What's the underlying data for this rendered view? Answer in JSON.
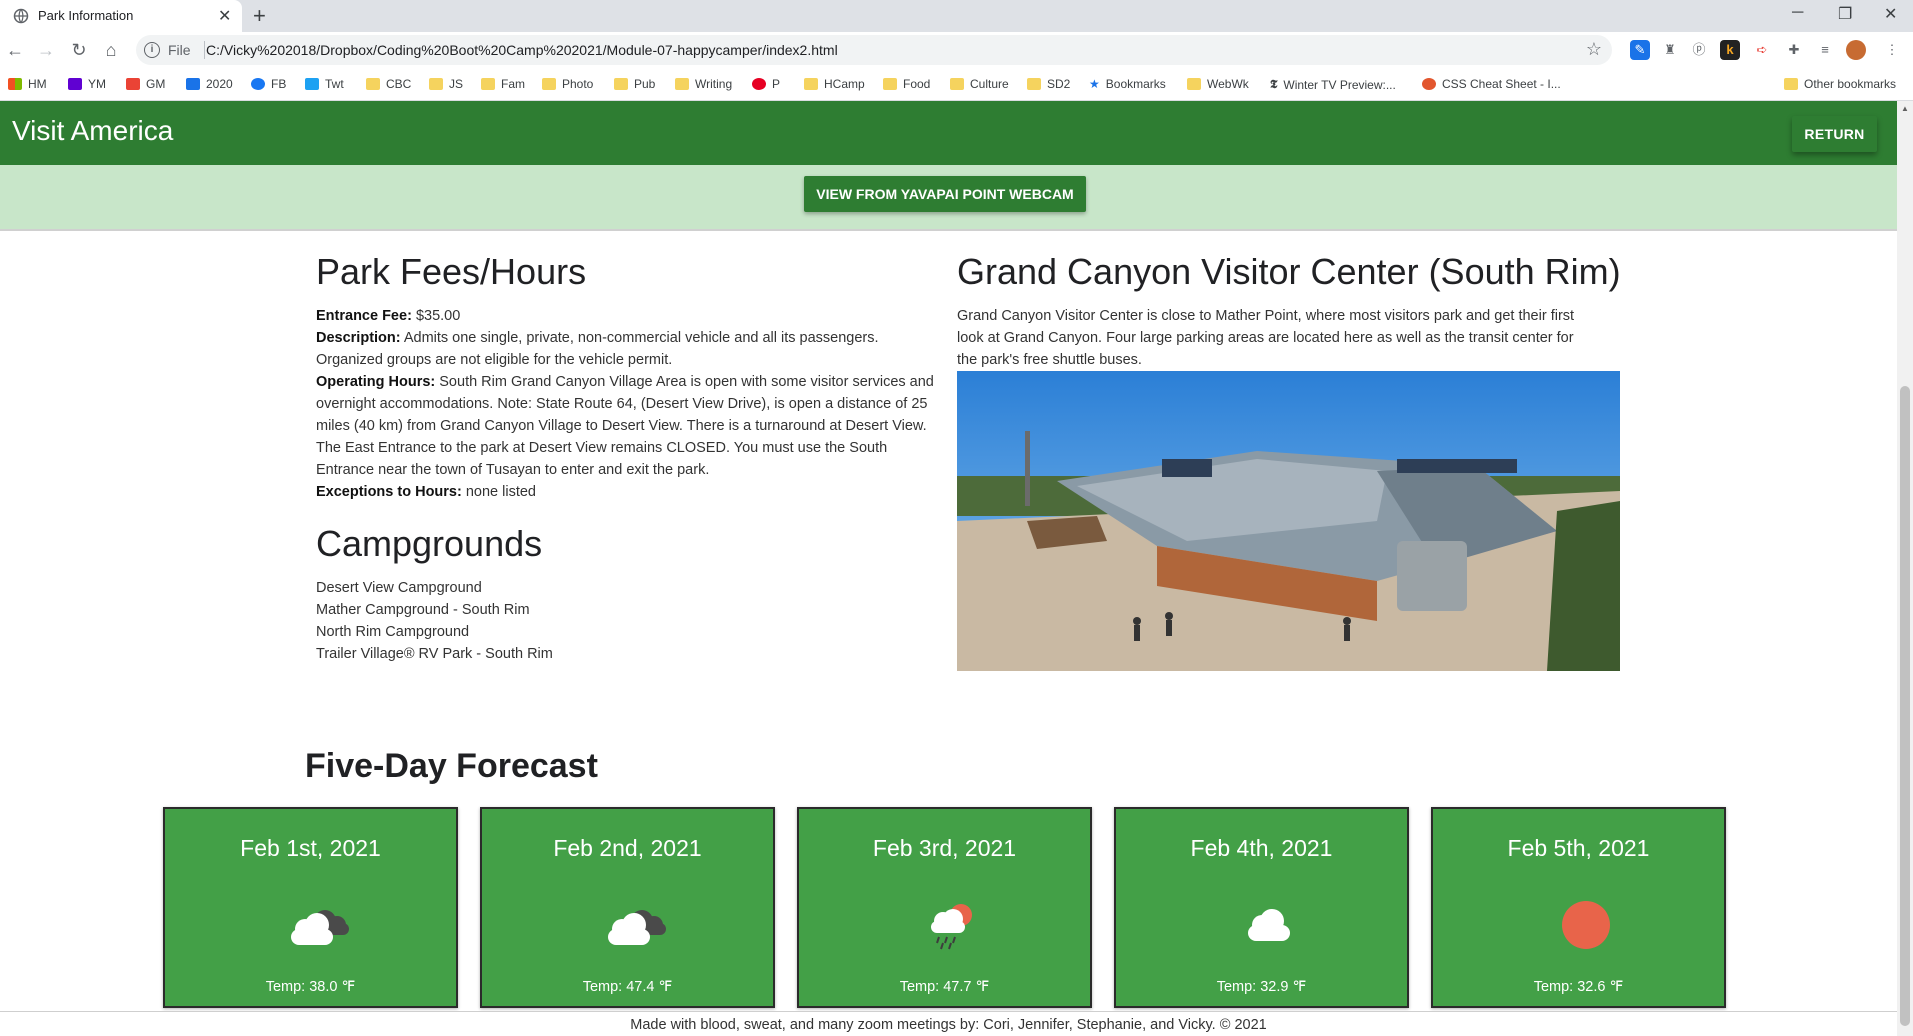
{
  "browser": {
    "tab_title": "Park Information",
    "url_scheme": "File",
    "url": "C:/Vicky%202018/Dropbox/Coding%20Boot%20Camp%202021/Module-07-happycamper/index2.html",
    "bookmarks": [
      "HM",
      "YM",
      "GM",
      "2020",
      "FB",
      "Twt",
      "CBC",
      "JS",
      "Fam",
      "Photo",
      "Pub",
      "Writing",
      "P",
      "HCamp",
      "Food",
      "Culture",
      "SD2",
      "Bookmarks",
      "WebWk",
      "Winter TV Preview:...",
      "CSS Cheat Sheet - I..."
    ],
    "other_bookmarks": "Other bookmarks"
  },
  "navbar": {
    "brand": "Visit America",
    "return_label": "RETURN"
  },
  "webcam": {
    "label": "VIEW FROM YAVAPAI POINT WEBCAM"
  },
  "fees": {
    "heading": "Park Fees/Hours",
    "entrance_label": "Entrance Fee:",
    "entrance_value": "$35.00",
    "description_label": "Description:",
    "description_value": "Admits one single, private, non-commercial vehicle and all its passengers. Organized groups are not eligible for the vehicle permit.",
    "hours_label": "Operating Hours:",
    "hours_value": "South Rim Grand Canyon Village Area is open with some visitor services and overnight accommodations. Note: State Route 64, (Desert View Drive), is open a distance of 25 miles (40 km) from Grand Canyon Village to Desert View. There is a turnaround at Desert View. The East Entrance to the park at Desert View remains CLOSED. You must use the South Entrance near the town of Tusayan to enter and exit the park.",
    "exceptions_label": "Exceptions to Hours:",
    "exceptions_value": "none listed"
  },
  "campgrounds": {
    "heading": "Campgrounds",
    "items": [
      "Desert View Campground",
      "Mather Campground - South Rim",
      "North Rim Campground",
      "Trailer Village® RV Park - South Rim"
    ]
  },
  "visitor_center": {
    "heading": "Grand Canyon Visitor Center (South Rim)",
    "description": "Grand Canyon Visitor Center is close to Mather Point, where most visitors park and get their first look at Grand Canyon. Four large parking areas are located here as well as the transit center for the park's free shuttle buses."
  },
  "forecast": {
    "heading": "Five-Day Forecast",
    "days": [
      {
        "date": "Feb 1st, 2021",
        "icon": "broken-clouds-icon",
        "temp": "Temp: 38.0 ℉"
      },
      {
        "date": "Feb 2nd, 2021",
        "icon": "broken-clouds-icon",
        "temp": "Temp: 47.4 ℉"
      },
      {
        "date": "Feb 3rd, 2021",
        "icon": "rain-sun-icon",
        "temp": "Temp: 47.7 ℉"
      },
      {
        "date": "Feb 4th, 2021",
        "icon": "cloud-icon",
        "temp": "Temp: 32.9 ℉"
      },
      {
        "date": "Feb 5th, 2021",
        "icon": "sun-icon",
        "temp": "Temp: 32.6 ℉"
      }
    ]
  },
  "footer": {
    "text": "Made with blood, sweat, and many zoom meetings by: Cori, Jennifer, Stephanie, and Vicky. © 2021"
  },
  "colors": {
    "navbar": "#2e7d32",
    "band": "#c8e6c9",
    "card": "#43a047",
    "sun": "#e8644a"
  }
}
